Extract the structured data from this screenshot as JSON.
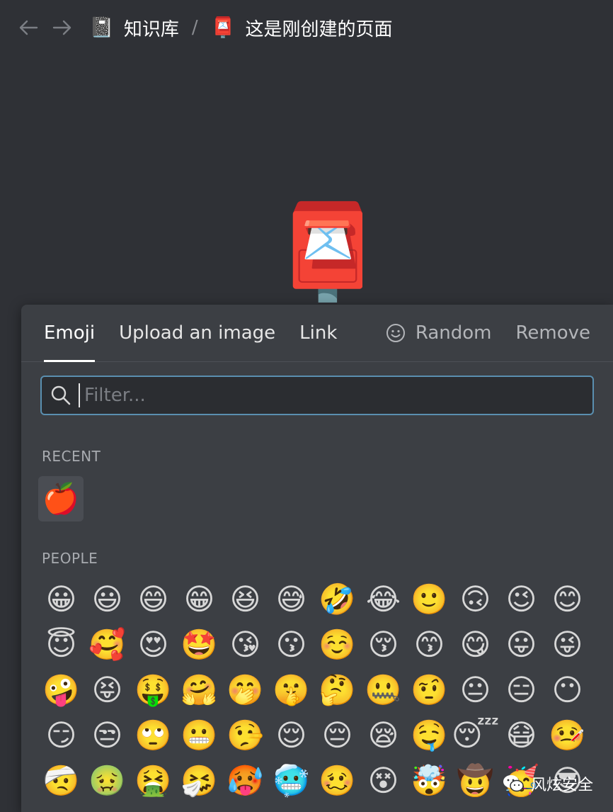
{
  "topbar": {
    "back_icon": "arrow-left-icon",
    "forward_icon": "arrow-right-icon",
    "breadcrumbs": [
      {
        "icon": "📓",
        "label": "知识库"
      },
      {
        "icon": "📮",
        "label": "这是刚创建的页面"
      }
    ],
    "separator": "/"
  },
  "page": {
    "icon": "📮"
  },
  "picker": {
    "tabs": [
      {
        "label": "Emoji",
        "active": true
      },
      {
        "label": "Upload an image",
        "active": false
      },
      {
        "label": "Link",
        "active": false
      }
    ],
    "random_label": "Random",
    "remove_label": "Remove",
    "filter_placeholder": "Filter...",
    "recent_label": "RECENT",
    "recent": [
      "🍎"
    ],
    "people_label": "PEOPLE",
    "people": [
      "😀",
      "😃",
      "😄",
      "😁",
      "😆",
      "😅",
      "🤣",
      "😂",
      "🙂",
      "🙃",
      "😉",
      "😊",
      "😇",
      "🥰",
      "😍",
      "🤩",
      "😘",
      "😗",
      "☺️",
      "😚",
      "😙",
      "😋",
      "😛",
      "😜",
      "🤪",
      "😝",
      "🤑",
      "🤗",
      "🤭",
      "🤫",
      "🤔",
      "🤐",
      "🤨",
      "😐",
      "😑",
      "😶",
      "😏",
      "😒",
      "🙄",
      "😬",
      "🤥",
      "😌",
      "😔",
      "😪",
      "🤤",
      "😴",
      "😷",
      "🤒",
      "🤕",
      "🤢",
      "🤮",
      "🤧",
      "🥵",
      "🥶",
      "🥴",
      "😵",
      "🤯",
      "🤠",
      "🥳",
      "😎"
    ]
  },
  "watermark": {
    "label": "风炫安全"
  }
}
